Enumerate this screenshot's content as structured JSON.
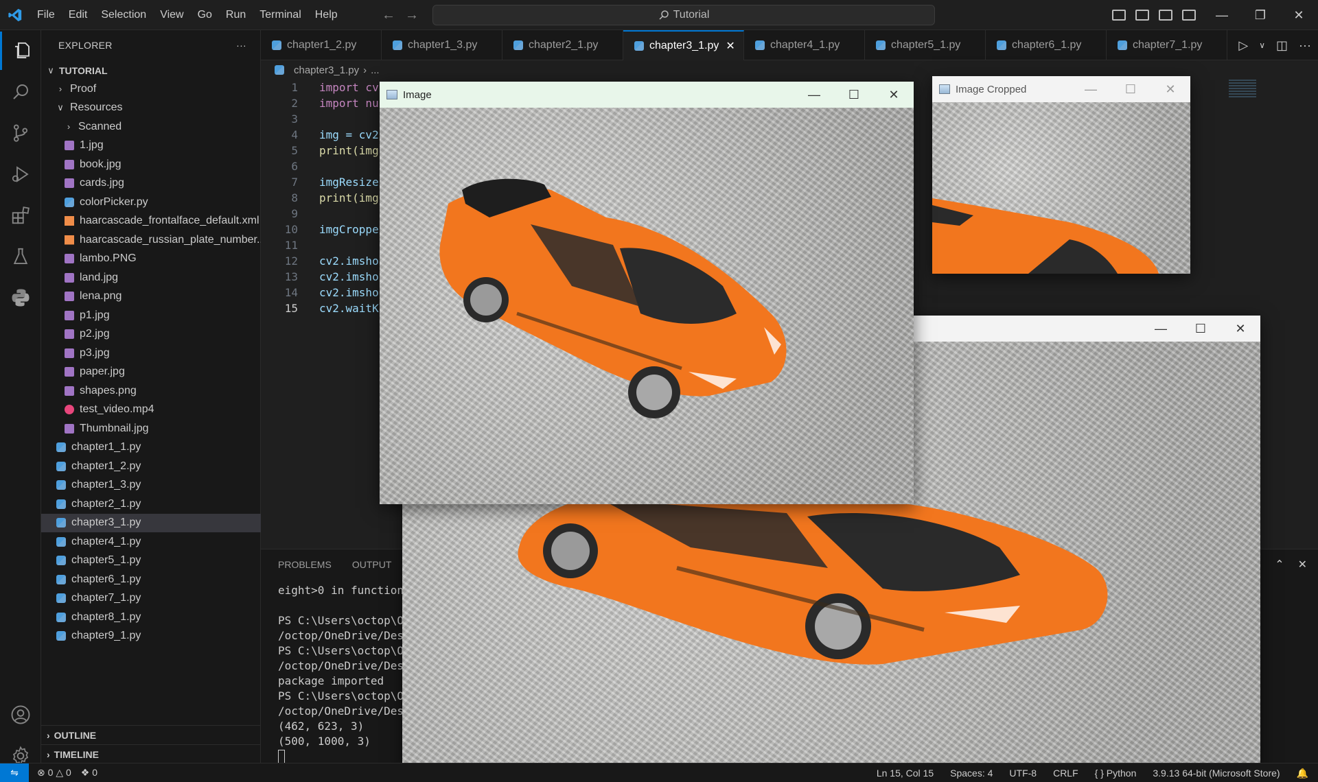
{
  "app": {
    "menu": [
      "File",
      "Edit",
      "Selection",
      "View",
      "Go",
      "Run",
      "Terminal",
      "Help"
    ],
    "search_text": "Tutorial",
    "accent": "#0078d4"
  },
  "explorer": {
    "header": "EXPLORER",
    "more": "···",
    "root": "TUTORIAL",
    "items": [
      {
        "label": "Proof",
        "type": "folder-collapsed",
        "depth": 1
      },
      {
        "label": "Resources",
        "type": "folder-expanded",
        "depth": 1
      },
      {
        "label": "Scanned",
        "type": "folder-collapsed",
        "depth": 2
      },
      {
        "label": "1.jpg",
        "type": "img",
        "depth": 2
      },
      {
        "label": "book.jpg",
        "type": "img",
        "depth": 2
      },
      {
        "label": "cards.jpg",
        "type": "img",
        "depth": 2
      },
      {
        "label": "colorPicker.py",
        "type": "py",
        "depth": 2
      },
      {
        "label": "haarcascade_frontalface_default.xml",
        "type": "xml",
        "depth": 2
      },
      {
        "label": "haarcascade_russian_plate_number....",
        "type": "xml",
        "depth": 2
      },
      {
        "label": "lambo.PNG",
        "type": "img",
        "depth": 2
      },
      {
        "label": "land.jpg",
        "type": "img",
        "depth": 2
      },
      {
        "label": "lena.png",
        "type": "img",
        "depth": 2
      },
      {
        "label": "p1.jpg",
        "type": "img",
        "depth": 2
      },
      {
        "label": "p2.jpg",
        "type": "img",
        "depth": 2
      },
      {
        "label": "p3.jpg",
        "type": "img",
        "depth": 2
      },
      {
        "label": "paper.jpg",
        "type": "img",
        "depth": 2
      },
      {
        "label": "shapes.png",
        "type": "img",
        "depth": 2
      },
      {
        "label": "test_video.mp4",
        "type": "video",
        "depth": 2
      },
      {
        "label": "Thumbnail.jpg",
        "type": "img",
        "depth": 2
      },
      {
        "label": "chapter1_1.py",
        "type": "py",
        "depth": 1
      },
      {
        "label": "chapter1_2.py",
        "type": "py",
        "depth": 1
      },
      {
        "label": "chapter1_3.py",
        "type": "py",
        "depth": 1
      },
      {
        "label": "chapter2_1.py",
        "type": "py",
        "depth": 1
      },
      {
        "label": "chapter3_1.py",
        "type": "py",
        "depth": 1,
        "selected": true
      },
      {
        "label": "chapter4_1.py",
        "type": "py",
        "depth": 1
      },
      {
        "label": "chapter5_1.py",
        "type": "py",
        "depth": 1
      },
      {
        "label": "chapter6_1.py",
        "type": "py",
        "depth": 1
      },
      {
        "label": "chapter7_1.py",
        "type": "py",
        "depth": 1
      },
      {
        "label": "chapter8_1.py",
        "type": "py",
        "depth": 1
      },
      {
        "label": "chapter9_1.py",
        "type": "py",
        "depth": 1
      }
    ],
    "outline": "OUTLINE",
    "timeline": "TIMELINE"
  },
  "tabs": [
    {
      "label": "chapter1_2.py",
      "active": false
    },
    {
      "label": "chapter1_3.py",
      "active": false
    },
    {
      "label": "chapter2_1.py",
      "active": false
    },
    {
      "label": "chapter3_1.py",
      "active": true
    },
    {
      "label": "chapter4_1.py",
      "active": false
    },
    {
      "label": "chapter5_1.py",
      "active": false
    },
    {
      "label": "chapter6_1.py",
      "active": false
    },
    {
      "label": "chapter7_1.py",
      "active": false
    }
  ],
  "breadcrumb": [
    "chapter3_1.py",
    "..."
  ],
  "code": [
    {
      "n": "1",
      "text": "import cv"
    },
    {
      "n": "2",
      "text": "import nu"
    },
    {
      "n": "3",
      "text": ""
    },
    {
      "n": "4",
      "text": "img = cv2"
    },
    {
      "n": "5",
      "text": "print(img"
    },
    {
      "n": "6",
      "text": ""
    },
    {
      "n": "7",
      "text": "imgResize"
    },
    {
      "n": "8",
      "text": "print(img"
    },
    {
      "n": "9",
      "text": ""
    },
    {
      "n": "10",
      "text": "imgCroppe"
    },
    {
      "n": "11",
      "text": ""
    },
    {
      "n": "12",
      "text": "cv2.imsho"
    },
    {
      "n": "13",
      "text": "cv2.imsho"
    },
    {
      "n": "14",
      "text": "cv2.imsho"
    },
    {
      "n": "15",
      "text": "cv2.waitK"
    }
  ],
  "current_line": "15",
  "panel": {
    "tabs": [
      "PROBLEMS",
      "OUTPUT"
    ],
    "lines": [
      "eight>0 in function",
      "",
      "PS C:\\Users\\octop\\On",
      "/octop/OneDrive/Desk",
      "PS C:\\Users\\octop\\On",
      "/octop/OneDrive/Desk",
      "package imported",
      "PS C:\\Users\\octop\\On",
      "/octop/OneDrive/Desk",
      "(462, 623, 3)",
      "(500, 1000, 3)"
    ]
  },
  "windows": {
    "image_title": "Image",
    "cropped_title": "Image Cropped",
    "resize_title": ""
  },
  "status": {
    "errors": "0",
    "warnings": "0",
    "ports": "0",
    "position": "Ln 15, Col 15",
    "spaces": "Spaces: 4",
    "encoding": "UTF-8",
    "eol": "CRLF",
    "language": "Python",
    "interpreter": "3.9.13 64-bit (Microsoft Store)"
  }
}
